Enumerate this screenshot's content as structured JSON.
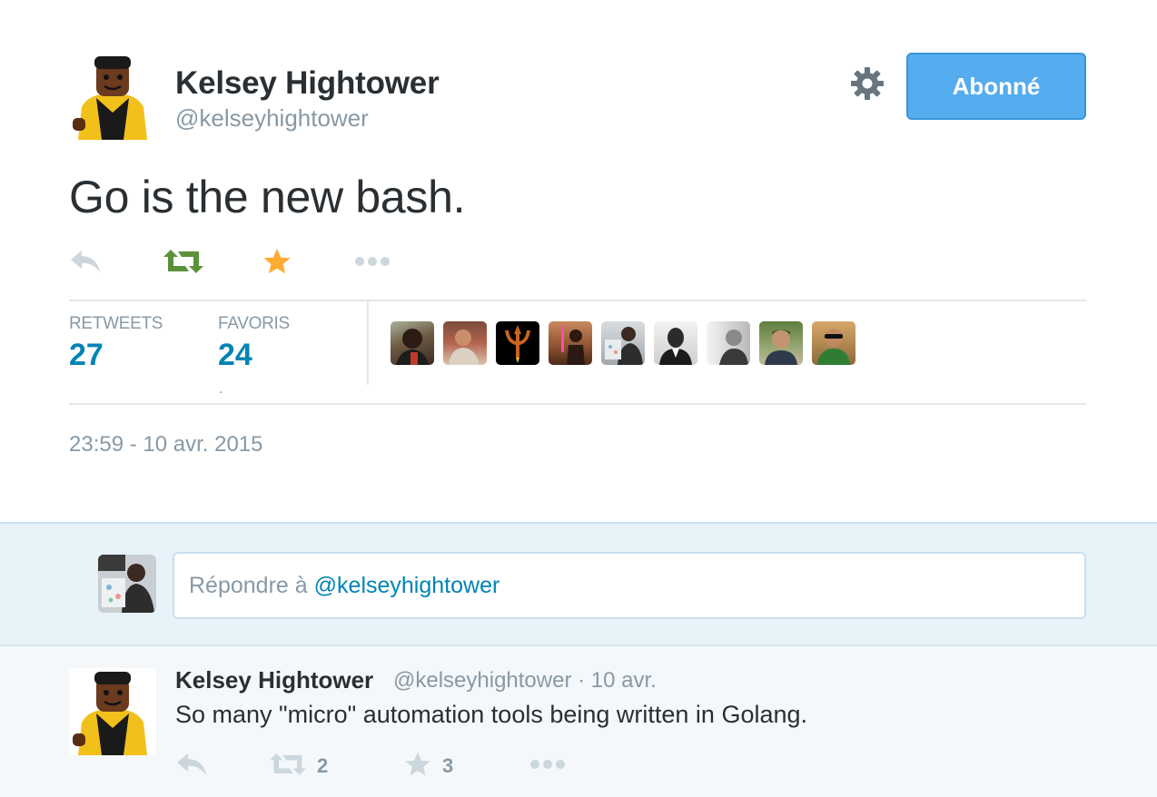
{
  "tweet": {
    "author": {
      "name": "Kelsey Hightower",
      "handle": "@kelseyhightower"
    },
    "follow_label": "Abonné",
    "text": "Go is the new bash.",
    "stats": {
      "retweets_label": "RETWEETS",
      "retweets_value": "27",
      "favorites_label": "FAVORIS",
      "favorites_value": "24",
      "stray_mark": "."
    },
    "timestamp": "23:59 - 10 avr. 2015",
    "favorited": true,
    "retweeted": true,
    "colors": {
      "retweet": "#5c913b",
      "favorite": "#ffac33",
      "link": "#0084b4",
      "follow_bg": "#55acee"
    }
  },
  "icons": [
    "reply-icon",
    "retweet-icon",
    "favorite-star-icon",
    "more-dots-icon",
    "gear-icon"
  ],
  "reply_box": {
    "placeholder_prefix": "Répondre à",
    "placeholder_mention": "@kelseyhightower"
  },
  "reply_tweet": {
    "name": "Kelsey Hightower",
    "meta": "@kelseyhightower · 10 avr.",
    "text": "So many \"micro\" automation tools being written in Golang.",
    "retweet_count": "2",
    "favorite_count": "3"
  }
}
